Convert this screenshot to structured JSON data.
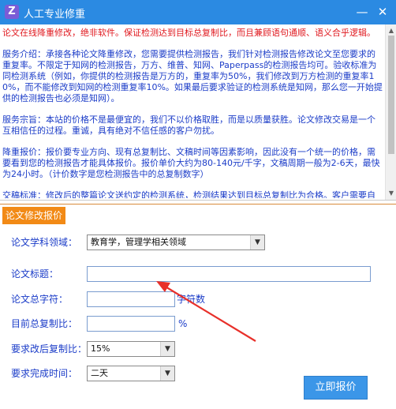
{
  "window": {
    "title": "人工专业修重",
    "minimize_glyph": "—",
    "close_glyph": "✕"
  },
  "info": {
    "intro": "论文在线降重修改，绝非软件。保证检测达到目标总复制比，而且兼顾语句通顺、语义合乎逻辑。",
    "service": "服务介绍：承接各种论文降重修改，您需要提供检测报告，我们针对检测报告修改论文至您要求的重复率。不限定于知网的检测报告，万方、维普、知网、Paperpass的检测报告均可。验收标准为同检测系统（例如，你提供的检测报告是万方的，重复率为50%，我们修改到万方检测的重复率10%，而不能修改到知网的检测重复率10%。如果最后要求验证的检测系统是知网，那么您一开始提供的检测报告也必须是知网）。",
    "purpose": "服务宗旨：本站的价格不是最便宜的，我们不以价格取胜，而是以质量获胜。论文修改交易是一个互相信任的过程。重诚，具有绝对不信任感的客户勿扰。",
    "pricing": "降重报价：报价要专业方向、现有总复制比、文稿时间等因素影响，因此没有一个统一的价格，需要看到您的检测报告才能具体报价。报价单价大约为80-140元/千字，文稿周期一般为2-6天，最快为24小时。（计价数字是您检测报告中的总复制数字）",
    "delivery": "交稿标准：修改后的整篇论文送约定的检测系统，检测结果达到目标总复制比为合格。客户需要自行检测费用，如果检测不达标，我们负责修改到合格为止且负责后续的检测。【注：如果原检测（修改前）不重复的文字，在二次检测（修改后）时变重复（即原有黑字变红）"
  },
  "form": {
    "group_title": "论文修改报价",
    "subject_label": "论文学科领域：",
    "subject_value": "教育学，管理学相关领域",
    "title_label": "论文标题：",
    "title_value": "",
    "chars_label": "论文总字符：",
    "chars_value": "",
    "chars_unit": "字符数",
    "current_label": "目前总复制比：",
    "current_value": "",
    "current_unit": "%",
    "target_label": "要求改后复制比：",
    "target_value": "15%",
    "time_label": "要求完成时间：",
    "time_value": "二天",
    "submit_label": "立即报价",
    "dropdown_glyph": "▼"
  },
  "scroll": {
    "up_glyph": "▲",
    "down_glyph": "▼"
  },
  "colors": {
    "titlebar": "#2b8ae2",
    "info_text": "#1b3cc8",
    "intro_text": "#e0191f",
    "group_title": "#f28a16",
    "button": "#3b96e8",
    "annotation_arrow": "#e8302a"
  }
}
